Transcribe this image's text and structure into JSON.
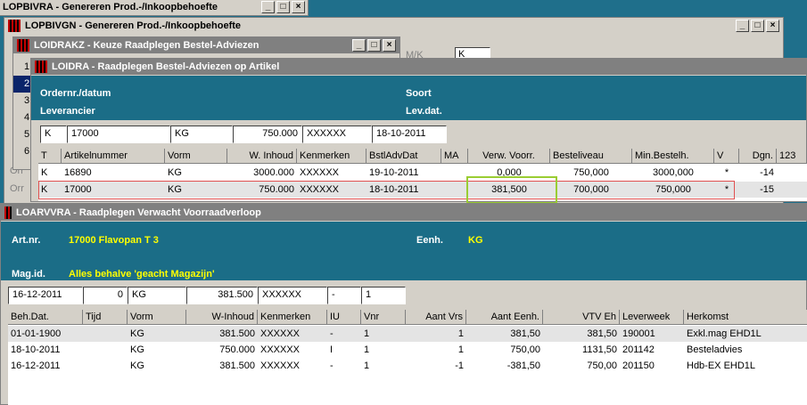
{
  "windows": {
    "lopbivra": {
      "title": "LOPBIVRA - Genereren Prod.-/Inkoopbehoefte"
    },
    "lopbivgn": {
      "title": "LOPBIVGN - Genereren Prod.-/Inkoopbehoefte"
    },
    "loidrakz": {
      "title": "LOIDRAKZ - Keuze Raadplegen Bestel-Adviezen"
    },
    "loidra": {
      "title": "LOIDRA - Raadplegen Bestel-Adviezen op Artikel"
    },
    "loarvvra": {
      "title": "LOARVVRA - Raadplegen Verwacht Voorraadverloop"
    }
  },
  "behind": {
    "row_numbers": [
      "1",
      "2",
      "3",
      "4",
      "5",
      "6"
    ],
    "side_labels": [
      "Orr",
      "Orr"
    ],
    "mk_label": "M/K",
    "mk_value": "K"
  },
  "loidra": {
    "labels": {
      "order": "Ordernr./datum",
      "soort": "Soort",
      "leverancier": "Leverancier",
      "levdat": "Lev.dat."
    },
    "filter": [
      "K",
      "17000",
      "KG",
      "750.000",
      "XXXXXX",
      "18-10-2011"
    ],
    "columns": [
      "T",
      "Artikelnummer",
      "Vorm",
      "W. Inhoud",
      "Kenmerken",
      "BstlAdvDat",
      "MA",
      "Verw. Voorr.",
      "Besteliveau",
      "Min.Bestelh.",
      "V",
      "Dgn.",
      "123"
    ],
    "rows": [
      [
        "K",
        "16890",
        "KG",
        "3000.000",
        "XXXXXX",
        "19-10-2011",
        "",
        "0,000",
        "750,000",
        "3000,000",
        "*",
        "-14",
        ""
      ],
      [
        "K",
        "17000",
        "KG",
        "750.000",
        "XXXXXX",
        "18-10-2011",
        "",
        "381,500",
        "700,000",
        "750,000",
        "*",
        "-15",
        ""
      ]
    ]
  },
  "loarvvra": {
    "labels": {
      "artnr": "Art.nr.",
      "eenh": "Eenh.",
      "magid": "Mag.id."
    },
    "values": {
      "artnr": "17000  Flavopan T 3",
      "eenh": "KG",
      "magid": "Alles behalve 'geacht Magazijn'"
    },
    "filter": [
      "16-12-2011",
      "0",
      "KG",
      "381.500",
      "XXXXXX",
      "-",
      "1"
    ],
    "columns": [
      "Beh.Dat.",
      "Tijd",
      "Vorm",
      "W-Inhoud",
      "Kenmerken",
      "IU",
      "Vnr",
      "Aant Vrs",
      "Aant Eenh.",
      "VTV Eh",
      "Leverweek",
      "Herkomst"
    ],
    "rows": [
      [
        "01-01-1900",
        "",
        "KG",
        "381.500",
        "XXXXXX",
        "-",
        "1",
        "1",
        "381,50",
        "381,50",
        "190001",
        "Exkl.mag EHD1L"
      ],
      [
        "18-10-2011",
        "",
        "KG",
        "750.000",
        "XXXXXX",
        "I",
        "1",
        "1",
        "750,00",
        "1131,50",
        "201142",
        "Besteladvies"
      ],
      [
        "16-12-2011",
        "",
        "KG",
        "381.500",
        "XXXXXX",
        "-",
        "1",
        "-1",
        "-381,50",
        "750,00",
        "201150",
        "Hdb-EX EHD1L"
      ]
    ]
  },
  "colors": {
    "teal": "#1b6d87",
    "highlight_border": "#9acd32",
    "selected_row_border": "#e05050",
    "accent_yellow": "#ffff00"
  }
}
